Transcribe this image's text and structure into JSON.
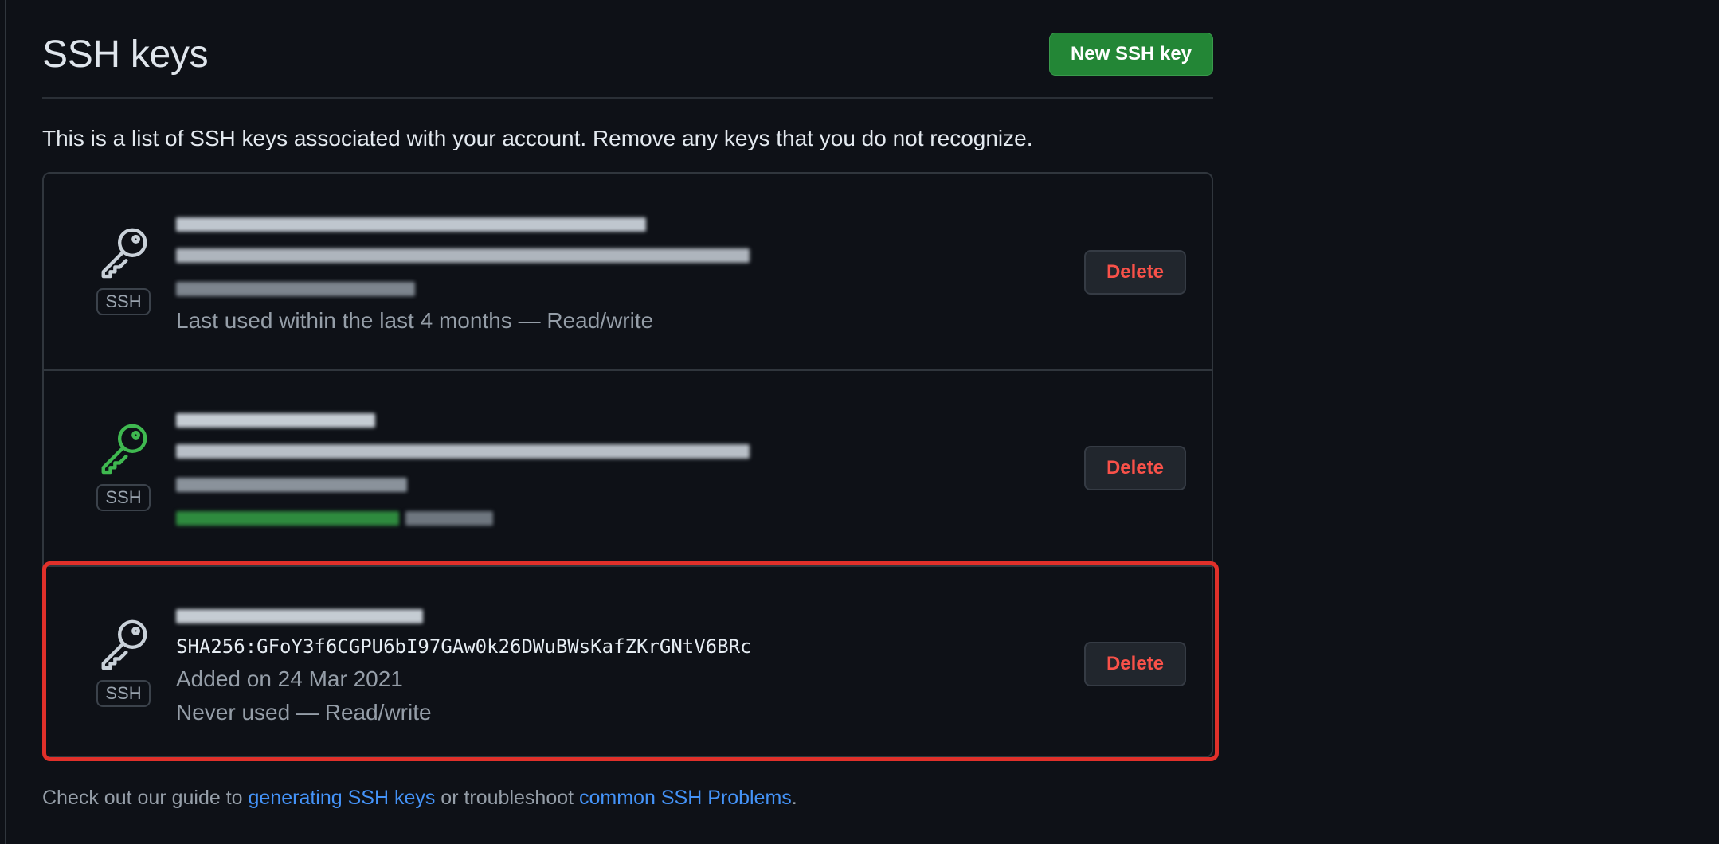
{
  "header": {
    "title": "SSH keys",
    "new_key_label": "New SSH key"
  },
  "intro_text": "This is a list of SSH keys associated with your account. Remove any keys that you do not recognize.",
  "keys": [
    {
      "title": "",
      "fingerprint": "",
      "added": "",
      "usage": "Last used within the last 4 months — Read/write",
      "badge": "SSH",
      "icon": "key-icon",
      "icon_color": "#c9d1d9",
      "delete_label": "Delete"
    },
    {
      "title": "",
      "fingerprint": "",
      "added": "",
      "usage": "",
      "badge": "SSH",
      "icon": "key-icon",
      "icon_color": "#3fb950",
      "delete_label": "Delete"
    },
    {
      "title": "",
      "fingerprint": "SHA256:GFoY3f6CGPU6bI97GAw0k26DWuBWsKafZKrGNtV6BRc",
      "added": "Added on 24 Mar 2021",
      "usage": "Never used — Read/write",
      "badge": "SSH",
      "icon": "key-icon",
      "icon_color": "#c9d1d9",
      "delete_label": "Delete"
    }
  ],
  "footer": {
    "prefix": "Check out our guide to ",
    "link1": "generating SSH keys",
    "middle": " or troubleshoot ",
    "link2": "common SSH Problems",
    "suffix": "."
  },
  "colors": {
    "background": "#0e1117",
    "primary_button": "#238636",
    "danger_text": "#f85149",
    "link": "#4493f8",
    "highlight": "#e0302a"
  }
}
